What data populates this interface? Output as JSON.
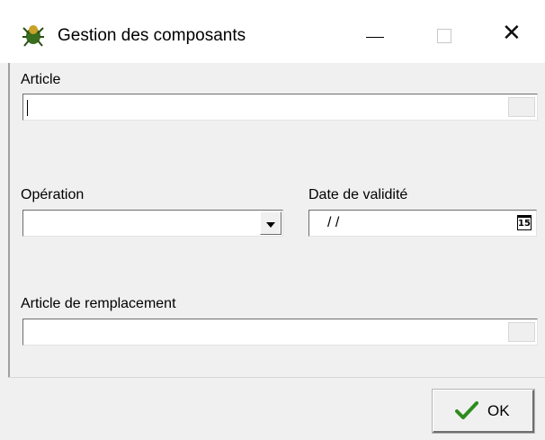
{
  "window": {
    "title": "Gestion des composants",
    "icon": "spider-app-icon",
    "controls": {
      "minimize": "—",
      "maximize": "□",
      "close": "✕"
    }
  },
  "form": {
    "article": {
      "label": "Article",
      "value": ""
    },
    "operation": {
      "label": "Opération",
      "value": ""
    },
    "date_validite": {
      "label": "Date de validité",
      "value": "/ /",
      "calendar_icon_text": "15"
    },
    "article_remplacement": {
      "label": "Article de remplacement",
      "value": ""
    }
  },
  "footer": {
    "ok_label": "OK",
    "ok_icon": "checkmark-icon"
  },
  "colors": {
    "window_bg": "#f0f0f0",
    "checkmark": "#2e8b1e"
  }
}
